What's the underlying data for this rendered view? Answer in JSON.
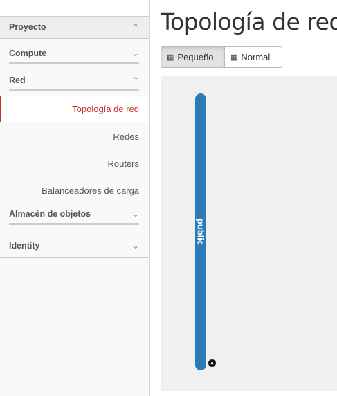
{
  "sidebar": {
    "sections": {
      "proyecto": {
        "label": "Proyecto",
        "chevron": "⌃"
      },
      "compute": {
        "label": "Compute",
        "chevron": "⌄"
      },
      "red": {
        "label": "Red",
        "chevron": "⌃"
      },
      "almacen": {
        "label": "Almacén de objetos",
        "chevron": "⌄"
      },
      "identity": {
        "label": "Identity",
        "chevron": "⌄"
      }
    },
    "red_items": [
      "Topología de red",
      "Redes",
      "Routers",
      "Balanceadores de carga"
    ]
  },
  "main": {
    "title": "Topología de red",
    "buttons": {
      "small": "Pequeño",
      "normal": "Normal"
    },
    "network_label": "public"
  },
  "colors": {
    "accent": "#c9302c",
    "network": "#2a7bb8"
  }
}
